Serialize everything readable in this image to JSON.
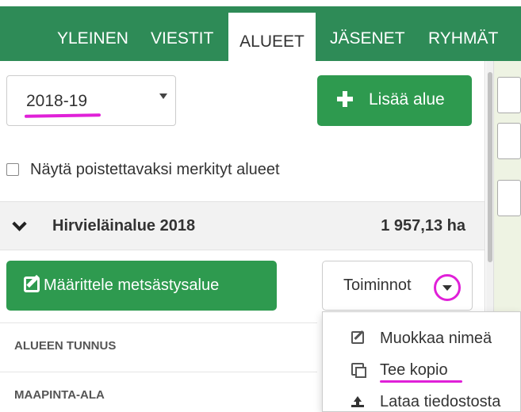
{
  "nav": {
    "tabs": [
      "YLEINEN",
      "VIESTIT",
      "ALUEET",
      "JÄSENET",
      "RYHMÄT"
    ],
    "active_tab": "ALUEET"
  },
  "season_select": {
    "value": "2018-19"
  },
  "add_area_button": {
    "label": "Lisää alue",
    "icon": "plus-icon"
  },
  "show_deleted_checkbox": {
    "label": "Näytä poistettavaksi merkityt alueet",
    "checked": false
  },
  "area": {
    "name": "Hirvieläinalue 2018",
    "size": "1 957,13 ha"
  },
  "define_button": {
    "label": "Määrittele metsästysalue",
    "icon": "edit-square-icon"
  },
  "actions_button": {
    "label": "Toiminnot"
  },
  "rows": [
    {
      "label": "ALUEEN TUNNUS"
    },
    {
      "label": "MAAPINTA-ALA"
    }
  ],
  "actions_menu": [
    {
      "label": "Muokkaa nimeä",
      "icon": "edit-icon"
    },
    {
      "label": "Tee kopio",
      "icon": "copy-icon"
    },
    {
      "label": "Lataa tiedostosta",
      "icon": "upload-icon"
    }
  ],
  "colors": {
    "nav_bg": "#2e8b57",
    "button_green": "#2e9a4f",
    "annotation_magenta": "#e020d8"
  }
}
